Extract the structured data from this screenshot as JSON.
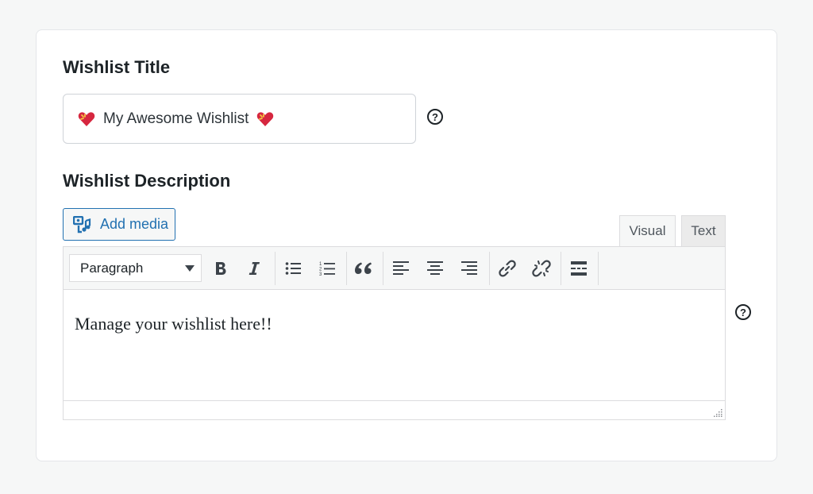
{
  "title_field": {
    "label": "Wishlist Title",
    "value": "My Awesome Wishlist",
    "help_icon": "question-circle-icon"
  },
  "description_field": {
    "label": "Wishlist Description",
    "add_media_label": "Add media",
    "tabs": [
      "Visual",
      "Text"
    ],
    "format_select": "Paragraph",
    "toolbar_icons": [
      "bold-icon",
      "italic-icon",
      "bulleted-list-icon",
      "numbered-list-icon",
      "blockquote-icon",
      "align-left-icon",
      "align-center-icon",
      "align-right-icon",
      "insert-link-icon",
      "remove-link-icon",
      "read-more-icon"
    ],
    "content": "Manage your wishlist here!!",
    "help_icon": "question-circle-icon"
  },
  "colors": {
    "accent": "#2271b1",
    "heart": "#d6273f"
  }
}
